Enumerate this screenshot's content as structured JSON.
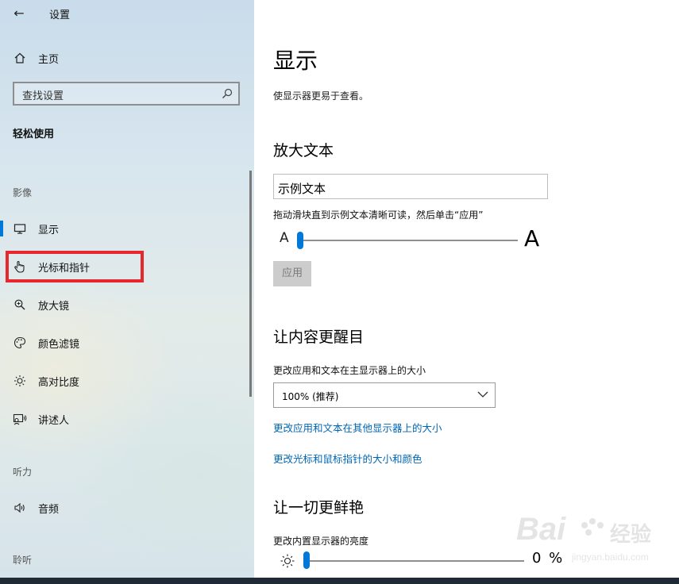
{
  "window": {
    "back_glyph": "←",
    "title": "设置"
  },
  "sidebar": {
    "home_label": "主页",
    "search_placeholder": "查找设置",
    "section_title": "轻松使用",
    "groups": {
      "vision": "影像",
      "hearing": "听力",
      "interaction": "聆听"
    },
    "items": [
      {
        "label": "显示",
        "icon": "monitor-icon",
        "active": true
      },
      {
        "label": "光标和指针",
        "icon": "hand-pointer-icon"
      },
      {
        "label": "放大镜",
        "icon": "magnifier-icon"
      },
      {
        "label": "颜色滤镜",
        "icon": "palette-icon"
      },
      {
        "label": "高对比度",
        "icon": "sun-contrast-icon"
      },
      {
        "label": "讲述人",
        "icon": "narrator-icon"
      },
      {
        "label": "音频",
        "icon": "speaker-icon"
      }
    ]
  },
  "main": {
    "title": "显示",
    "description": "使显示器更易于查看。",
    "text_size": {
      "heading": "放大文本",
      "sample_text": "示例文本",
      "instruction": "拖动滑块直到示例文本清晰可读，然后单击“应用”",
      "small_a": "A",
      "big_a": "A",
      "slider_value": 0,
      "apply_label": "应用"
    },
    "bigger": {
      "heading": "让内容更醒目",
      "scale_label": "更改应用和文本在主显示器上的大小",
      "scale_value": "100% (推荐)",
      "link_other_displays": "更改应用和文本在其他显示器上的大小",
      "link_cursor": "更改光标和鼠标指针的大小和颜色"
    },
    "brighter": {
      "heading": "让一切更鲜艳",
      "brightness_label": "更改内置显示器的亮度",
      "brightness_value": "0 %",
      "brightness_fraction": 0
    }
  },
  "watermark": {
    "brand": "Baidu经验",
    "url": "jingyan.baidu.com"
  },
  "colors": {
    "accent": "#0078d7",
    "link": "#0066b4",
    "highlight": "#e8262d"
  }
}
